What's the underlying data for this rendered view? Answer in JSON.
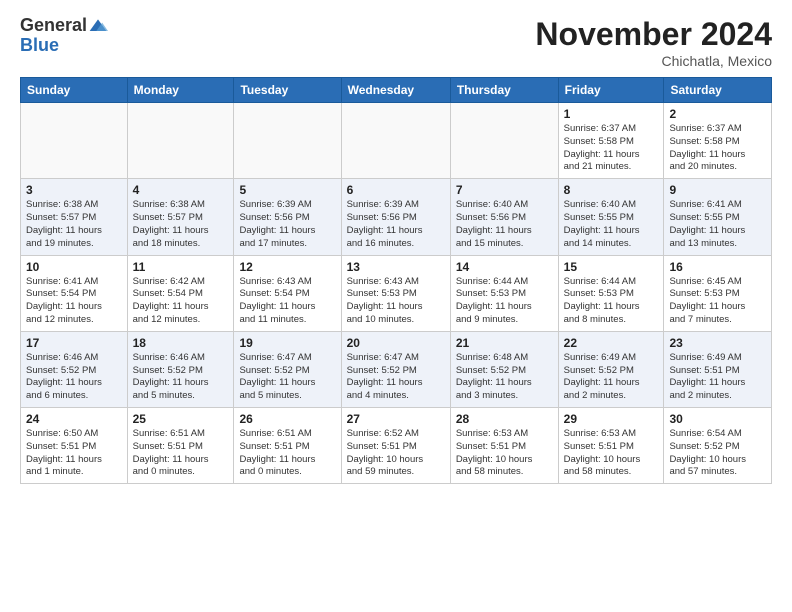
{
  "logo": {
    "general": "General",
    "blue": "Blue"
  },
  "header": {
    "month": "November 2024",
    "location": "Chichatla, Mexico"
  },
  "weekdays": [
    "Sunday",
    "Monday",
    "Tuesday",
    "Wednesday",
    "Thursday",
    "Friday",
    "Saturday"
  ],
  "weeks": [
    [
      {
        "day": "",
        "info": ""
      },
      {
        "day": "",
        "info": ""
      },
      {
        "day": "",
        "info": ""
      },
      {
        "day": "",
        "info": ""
      },
      {
        "day": "",
        "info": ""
      },
      {
        "day": "1",
        "info": "Sunrise: 6:37 AM\nSunset: 5:58 PM\nDaylight: 11 hours\nand 21 minutes."
      },
      {
        "day": "2",
        "info": "Sunrise: 6:37 AM\nSunset: 5:58 PM\nDaylight: 11 hours\nand 20 minutes."
      }
    ],
    [
      {
        "day": "3",
        "info": "Sunrise: 6:38 AM\nSunset: 5:57 PM\nDaylight: 11 hours\nand 19 minutes."
      },
      {
        "day": "4",
        "info": "Sunrise: 6:38 AM\nSunset: 5:57 PM\nDaylight: 11 hours\nand 18 minutes."
      },
      {
        "day": "5",
        "info": "Sunrise: 6:39 AM\nSunset: 5:56 PM\nDaylight: 11 hours\nand 17 minutes."
      },
      {
        "day": "6",
        "info": "Sunrise: 6:39 AM\nSunset: 5:56 PM\nDaylight: 11 hours\nand 16 minutes."
      },
      {
        "day": "7",
        "info": "Sunrise: 6:40 AM\nSunset: 5:56 PM\nDaylight: 11 hours\nand 15 minutes."
      },
      {
        "day": "8",
        "info": "Sunrise: 6:40 AM\nSunset: 5:55 PM\nDaylight: 11 hours\nand 14 minutes."
      },
      {
        "day": "9",
        "info": "Sunrise: 6:41 AM\nSunset: 5:55 PM\nDaylight: 11 hours\nand 13 minutes."
      }
    ],
    [
      {
        "day": "10",
        "info": "Sunrise: 6:41 AM\nSunset: 5:54 PM\nDaylight: 11 hours\nand 12 minutes."
      },
      {
        "day": "11",
        "info": "Sunrise: 6:42 AM\nSunset: 5:54 PM\nDaylight: 11 hours\nand 12 minutes."
      },
      {
        "day": "12",
        "info": "Sunrise: 6:43 AM\nSunset: 5:54 PM\nDaylight: 11 hours\nand 11 minutes."
      },
      {
        "day": "13",
        "info": "Sunrise: 6:43 AM\nSunset: 5:53 PM\nDaylight: 11 hours\nand 10 minutes."
      },
      {
        "day": "14",
        "info": "Sunrise: 6:44 AM\nSunset: 5:53 PM\nDaylight: 11 hours\nand 9 minutes."
      },
      {
        "day": "15",
        "info": "Sunrise: 6:44 AM\nSunset: 5:53 PM\nDaylight: 11 hours\nand 8 minutes."
      },
      {
        "day": "16",
        "info": "Sunrise: 6:45 AM\nSunset: 5:53 PM\nDaylight: 11 hours\nand 7 minutes."
      }
    ],
    [
      {
        "day": "17",
        "info": "Sunrise: 6:46 AM\nSunset: 5:52 PM\nDaylight: 11 hours\nand 6 minutes."
      },
      {
        "day": "18",
        "info": "Sunrise: 6:46 AM\nSunset: 5:52 PM\nDaylight: 11 hours\nand 5 minutes."
      },
      {
        "day": "19",
        "info": "Sunrise: 6:47 AM\nSunset: 5:52 PM\nDaylight: 11 hours\nand 5 minutes."
      },
      {
        "day": "20",
        "info": "Sunrise: 6:47 AM\nSunset: 5:52 PM\nDaylight: 11 hours\nand 4 minutes."
      },
      {
        "day": "21",
        "info": "Sunrise: 6:48 AM\nSunset: 5:52 PM\nDaylight: 11 hours\nand 3 minutes."
      },
      {
        "day": "22",
        "info": "Sunrise: 6:49 AM\nSunset: 5:52 PM\nDaylight: 11 hours\nand 2 minutes."
      },
      {
        "day": "23",
        "info": "Sunrise: 6:49 AM\nSunset: 5:51 PM\nDaylight: 11 hours\nand 2 minutes."
      }
    ],
    [
      {
        "day": "24",
        "info": "Sunrise: 6:50 AM\nSunset: 5:51 PM\nDaylight: 11 hours\nand 1 minute."
      },
      {
        "day": "25",
        "info": "Sunrise: 6:51 AM\nSunset: 5:51 PM\nDaylight: 11 hours\nand 0 minutes."
      },
      {
        "day": "26",
        "info": "Sunrise: 6:51 AM\nSunset: 5:51 PM\nDaylight: 11 hours\nand 0 minutes."
      },
      {
        "day": "27",
        "info": "Sunrise: 6:52 AM\nSunset: 5:51 PM\nDaylight: 10 hours\nand 59 minutes."
      },
      {
        "day": "28",
        "info": "Sunrise: 6:53 AM\nSunset: 5:51 PM\nDaylight: 10 hours\nand 58 minutes."
      },
      {
        "day": "29",
        "info": "Sunrise: 6:53 AM\nSunset: 5:51 PM\nDaylight: 10 hours\nand 58 minutes."
      },
      {
        "day": "30",
        "info": "Sunrise: 6:54 AM\nSunset: 5:52 PM\nDaylight: 10 hours\nand 57 minutes."
      }
    ]
  ]
}
